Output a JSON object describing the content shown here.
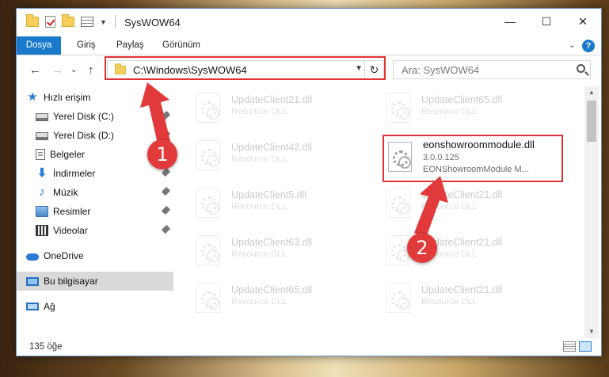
{
  "window": {
    "title": "SysWOW64",
    "controls": {
      "minimize": "—",
      "maximize": "☐",
      "close": "✕"
    }
  },
  "ribbon": {
    "tabs": [
      "Dosya",
      "Giriş",
      "Paylaş",
      "Görünüm"
    ],
    "help": "?",
    "collapse": "⌄"
  },
  "nav": {
    "back": "←",
    "forward": "→",
    "up": "↑",
    "recent": "⌄",
    "address": "C:\\Windows\\SysWOW64",
    "refresh": "↻",
    "search_placeholder": "Ara: SysWOW64"
  },
  "sidebar": {
    "items": [
      {
        "label": "Hızlı erişim",
        "icon": "star-icon"
      },
      {
        "label": "Yerel Disk (C:)",
        "icon": "drive-icon",
        "pinned": true
      },
      {
        "label": "Yerel Disk (D:)",
        "icon": "drive-icon",
        "pinned": true
      },
      {
        "label": "Belgeler",
        "icon": "documents-icon",
        "pinned": true
      },
      {
        "label": "İndirmeler",
        "icon": "download-icon",
        "pinned": true
      },
      {
        "label": "Müzik",
        "icon": "music-icon",
        "pinned": true
      },
      {
        "label": "Resimler",
        "icon": "pictures-icon",
        "pinned": true
      },
      {
        "label": "Videolar",
        "icon": "videos-icon",
        "pinned": true
      },
      {
        "label": "OneDrive",
        "icon": "onedrive-icon"
      },
      {
        "label": "Bu bilgisayar",
        "icon": "this-pc-icon",
        "selected": true
      },
      {
        "label": "Ağ",
        "icon": "network-icon"
      }
    ]
  },
  "files": {
    "left": [
      {
        "name": "UpdateClient21.dll",
        "type": "Resource DLL"
      },
      {
        "name": "UpdateClient42.dll",
        "type": "Resource DLL"
      },
      {
        "name": "UpdateClient5.dll",
        "type": "Resource DLL"
      },
      {
        "name": "UpdateClient63.dll",
        "type": "Resource DLL"
      },
      {
        "name": "UpdateClient65.dll",
        "type": "Resource DLL"
      }
    ],
    "right": [
      {
        "name": "UpdateClient65.dll",
        "type": "Resource DLL"
      },
      {
        "name": "eonshowroommodule.dll",
        "version": "3.0.0.125",
        "description": "EONShowroomModule M...",
        "highlighted": true
      },
      {
        "name": "UpdateClient21.dll",
        "type": "Resource DLL"
      },
      {
        "name": "UpdateClient21.dll",
        "type": "Resource DLL"
      },
      {
        "name": "UpdateClient21.dll",
        "type": "Resource DLL"
      }
    ]
  },
  "status": {
    "item_count": "135 öğe"
  },
  "annotations": {
    "callout1": "1",
    "callout2": "2",
    "color": "#e03232"
  },
  "colors": {
    "accent": "#1979ca",
    "selected": "#d9d9d9"
  }
}
